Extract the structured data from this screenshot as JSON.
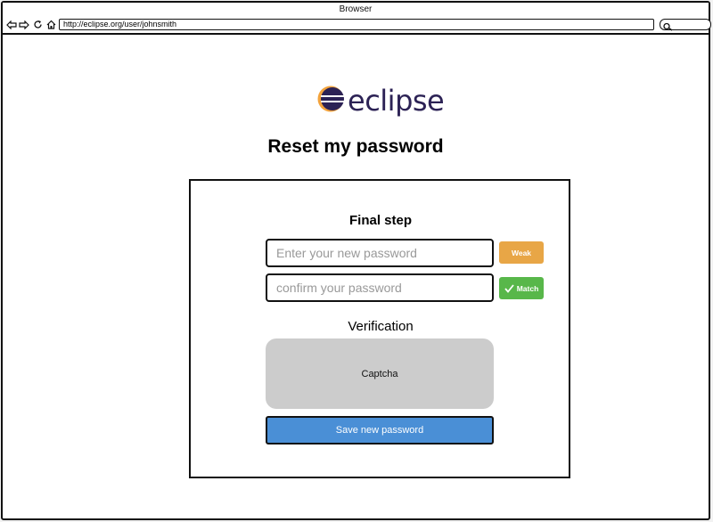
{
  "window": {
    "title": "Browser"
  },
  "toolbar": {
    "url": "http://eclipse.org/user/johnsmith",
    "icons": [
      "back-arrow-icon",
      "forward-arrow-icon",
      "refresh-icon",
      "home-icon",
      "search-icon"
    ]
  },
  "brand": {
    "logo_text": "eclipse"
  },
  "page": {
    "title": "Reset my password"
  },
  "form": {
    "step_title": "Final step",
    "new_password_placeholder": "Enter your new password",
    "confirm_password_placeholder": "confirm your password",
    "strength_label": "Weak",
    "match_label": "Match",
    "verification_title": "Verification",
    "captcha_label": "Captcha",
    "save_label": "Save new password"
  },
  "colors": {
    "weak": "#e8a646",
    "match": "#58b74a",
    "save_button": "#4a8fd6",
    "captcha_bg": "#cccccc",
    "brand_purple": "#2c2255",
    "brand_orange": "#f3a33c"
  }
}
